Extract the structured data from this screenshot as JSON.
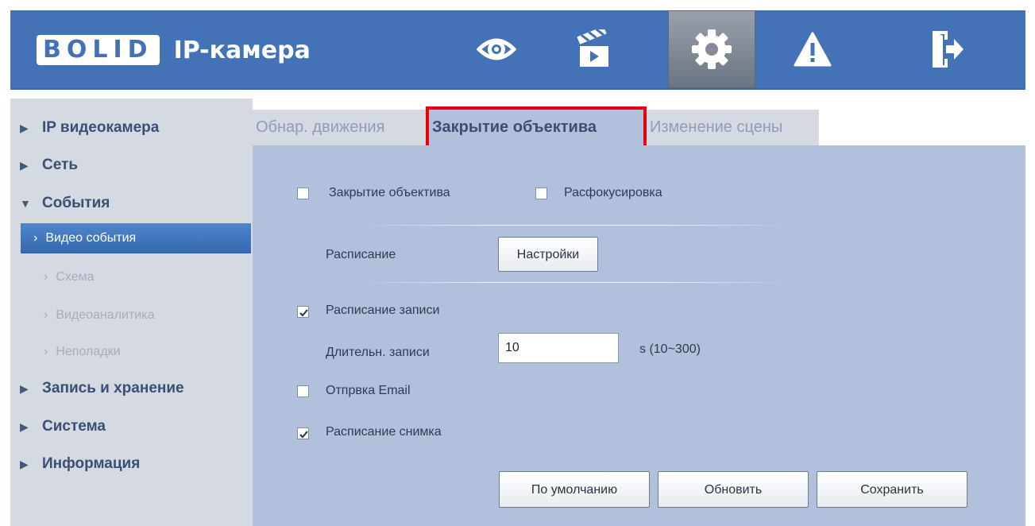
{
  "header": {
    "logo_text": "BOLID",
    "title": "IP-камера",
    "nav": [
      {
        "icon": "eye-icon"
      },
      {
        "icon": "clapperboard-icon"
      },
      {
        "icon": "gear-icon",
        "active": true
      },
      {
        "icon": "warning-icon"
      },
      {
        "icon": "logout-icon"
      }
    ]
  },
  "sidebar": {
    "items": [
      {
        "label": "IP видеокамера",
        "level": 0,
        "expanded": false
      },
      {
        "label": "Сеть",
        "level": 0,
        "expanded": false
      },
      {
        "label": "События",
        "level": 0,
        "expanded": true
      },
      {
        "label": "Видео события",
        "level": 1,
        "active": true
      },
      {
        "label": "Схема",
        "level": 1
      },
      {
        "label": "Видеоаналитика",
        "level": 1
      },
      {
        "label": "Неполадки",
        "level": 1
      },
      {
        "label": "Запись и хранение",
        "level": 0,
        "expanded": false
      },
      {
        "label": "Система",
        "level": 0,
        "expanded": false
      },
      {
        "label": "Информация",
        "level": 0,
        "expanded": false
      }
    ]
  },
  "tabs": [
    {
      "label": "Обнар. движения",
      "active": false
    },
    {
      "label": "Закрытие объектива",
      "active": true
    },
    {
      "label": "Изменение сцены",
      "active": false
    }
  ],
  "form": {
    "lens_cover": {
      "label": "Закрытие объектива",
      "checked": false
    },
    "defocus": {
      "label": "Расфокусировка",
      "checked": false
    },
    "schedule_label": "Расписание",
    "settings_button": "Настройки",
    "record_schedule": {
      "label": "Расписание записи",
      "checked": true
    },
    "record_duration": {
      "label": "Длительн. записи",
      "value": "10",
      "unit": "s (10~300)"
    },
    "send_email": {
      "label": "Отпрвка Email",
      "checked": false
    },
    "snapshot_schedule": {
      "label": "Расписание снимка",
      "checked": true
    }
  },
  "actions": {
    "default": "По умолчанию",
    "refresh": "Обновить",
    "save": "Сохранить"
  },
  "colors": {
    "header_bg": "#4373b6",
    "content_bg": "#b1c1dc",
    "sidebar_bg": "#d4d9e2",
    "active_item_bg": "#3f76bd",
    "highlight_border": "#e8000d"
  }
}
